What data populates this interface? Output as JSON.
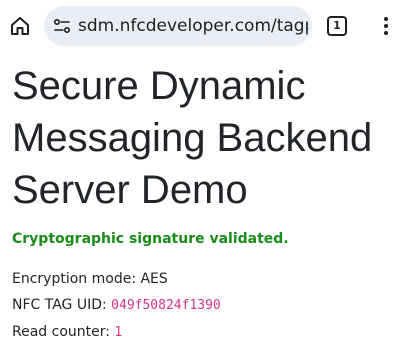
{
  "browser": {
    "url": "sdm.nfcdeveloper.com/tagpt",
    "tab_count": "1",
    "icons": {
      "home": "home-icon",
      "site_info": "site-settings-icon",
      "menu": "more-vert-icon"
    }
  },
  "page": {
    "title": "Secure Dynamic Messaging Backend Server Demo",
    "status": "Cryptographic signature validated.",
    "status_color": "#198c19",
    "info": {
      "encryption_label": "Encryption mode:",
      "encryption_value": "AES",
      "uid_label": "NFC TAG UID:",
      "uid_value": "049f50824f1390",
      "counter_label": "Read counter:",
      "counter_value": "1"
    },
    "code_color": "#d63384"
  }
}
